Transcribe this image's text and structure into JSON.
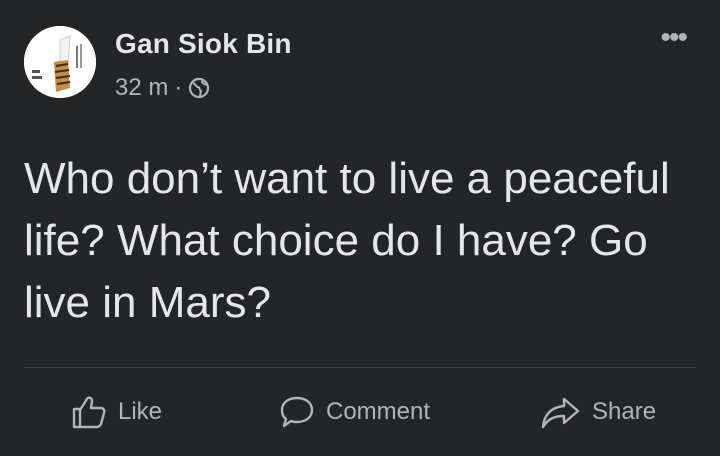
{
  "post": {
    "author": "Gan Siok Bin",
    "time": "32 m",
    "separator": "·",
    "privacy_icon": "globe-icon",
    "more_label": "•••",
    "text": "Who don’t want to live a peaceful life? What choice do I have? Go live in Mars?"
  },
  "actions": {
    "like_label": "Like",
    "comment_label": "Comment",
    "share_label": "Share"
  },
  "colors": {
    "background": "#242526",
    "primary_text": "#e4e6eb",
    "secondary_text": "#b0b3b8",
    "divider": "#3e4042"
  }
}
